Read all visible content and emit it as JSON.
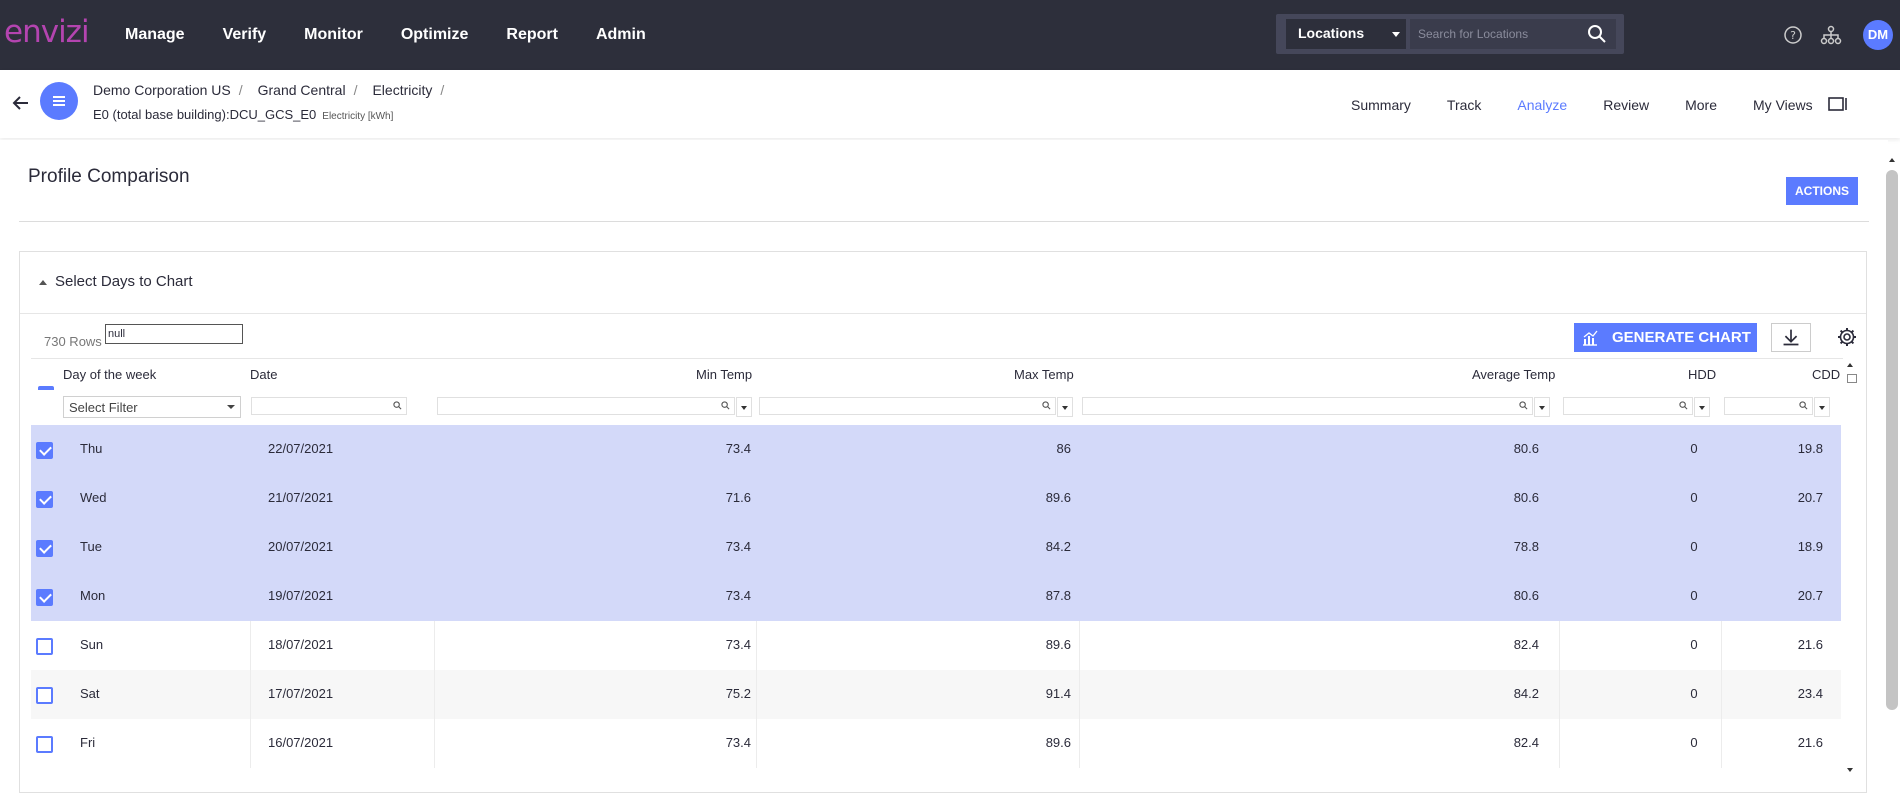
{
  "brand": {
    "logo": "envizi",
    "accent": "#5b7bff",
    "logo_color": "#b444b0"
  },
  "nav": {
    "items": [
      "Manage",
      "Verify",
      "Monitor",
      "Optimize",
      "Report",
      "Admin"
    ]
  },
  "location_search": {
    "selector": "Locations",
    "placeholder": "Search for Locations"
  },
  "user": {
    "initials": "DM"
  },
  "breadcrumb": {
    "items": [
      "Demo Corporation US",
      "Grand Central",
      "Electricity"
    ],
    "separator": "/",
    "entity": "E0 (total base building):DCU_GCS_E0",
    "unit": "Electricity [kWh]"
  },
  "tabs": [
    "Summary",
    "Track",
    "Analyze",
    "Review",
    "More",
    "My Views"
  ],
  "active_tab": "Analyze",
  "page": {
    "title": "Profile Comparison",
    "actions_label": "ACTIONS"
  },
  "section": {
    "title": "Select Days to Chart"
  },
  "toolbar": {
    "rows_count": "730 Rows",
    "null_value": "null",
    "generate_label": "GENERATE CHART"
  },
  "grid": {
    "columns": [
      "Day of the week",
      "Date",
      "Min Temp",
      "Max Temp",
      "Average Temp",
      "HDD",
      "CDD"
    ],
    "filter_placeholder": "Select Filter",
    "rows": [
      {
        "selected": true,
        "day": "Thu",
        "date": "22/07/2021",
        "min": "73.4",
        "max": "86",
        "avg": "80.6",
        "hdd": "0",
        "cdd": "19.8"
      },
      {
        "selected": true,
        "day": "Wed",
        "date": "21/07/2021",
        "min": "71.6",
        "max": "89.6",
        "avg": "80.6",
        "hdd": "0",
        "cdd": "20.7"
      },
      {
        "selected": true,
        "day": "Tue",
        "date": "20/07/2021",
        "min": "73.4",
        "max": "84.2",
        "avg": "78.8",
        "hdd": "0",
        "cdd": "18.9"
      },
      {
        "selected": true,
        "day": "Mon",
        "date": "19/07/2021",
        "min": "73.4",
        "max": "87.8",
        "avg": "80.6",
        "hdd": "0",
        "cdd": "20.7"
      },
      {
        "selected": false,
        "day": "Sun",
        "date": "18/07/2021",
        "min": "73.4",
        "max": "89.6",
        "avg": "82.4",
        "hdd": "0",
        "cdd": "21.6"
      },
      {
        "selected": false,
        "day": "Sat",
        "date": "17/07/2021",
        "min": "75.2",
        "max": "91.4",
        "avg": "84.2",
        "hdd": "0",
        "cdd": "23.4"
      },
      {
        "selected": false,
        "day": "Fri",
        "date": "16/07/2021",
        "min": "73.4",
        "max": "89.6",
        "avg": "82.4",
        "hdd": "0",
        "cdd": "21.6"
      }
    ]
  }
}
